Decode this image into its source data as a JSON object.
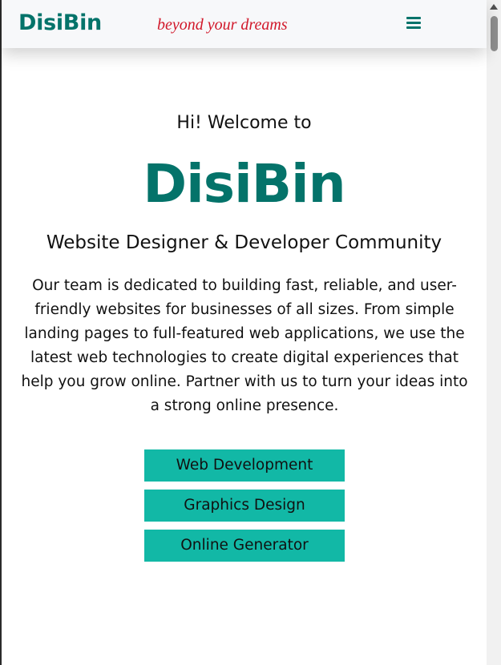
{
  "header": {
    "logo": "DisiBin",
    "tagline": "beyond your dreams",
    "menu_icon": "hamburger-menu-icon"
  },
  "hero": {
    "welcome": "Hi! Welcome to",
    "title": "DisiBin",
    "subtitle": "Website Designer & Developer Community",
    "description": "Our team is dedicated to building fast, reliable, and user-friendly websites for businesses of all sizes. From simple landing pages to full-featured web applications, we use the latest web technologies to create digital experiences that help you grow online. Partner with us to turn your ideas into a strong online presence."
  },
  "actions": [
    {
      "label": "Web Development"
    },
    {
      "label": "Graphics Design"
    },
    {
      "label": "Online Generator"
    }
  ],
  "colors": {
    "brand": "#04736a",
    "tagline": "#d1182a",
    "button": "#12b8a6",
    "header_bg": "#f7f8fa"
  }
}
